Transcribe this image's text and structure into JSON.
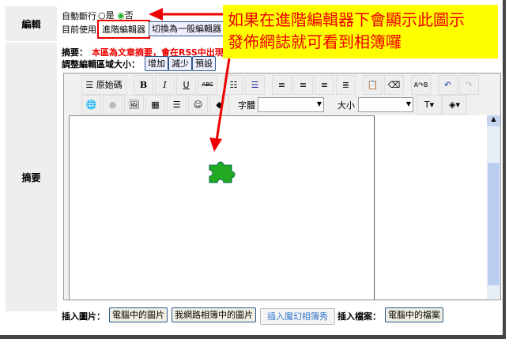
{
  "labels": {
    "edit": "編輯",
    "summary": "摘要"
  },
  "auto_wrap": {
    "label": "自動斷行",
    "yes": "是",
    "no": "否",
    "selected": "no"
  },
  "current": {
    "label": "目前使用",
    "advanced": "進階編輯器",
    "switch": "切換為一般編輯器"
  },
  "summary_note": {
    "label": "摘要：",
    "text": "本區為文章摘要，會在RSS中出現"
  },
  "resize": {
    "label": "調整編輯區域大小：",
    "increase": "增加",
    "decrease": "減少",
    "default": "預設"
  },
  "toolbar": {
    "source": "原始碼",
    "bold": "B",
    "italic": "I",
    "underline": "U",
    "strike": "ABC",
    "font_label": "字體",
    "size_label": "大小",
    "font_value": "",
    "size_value": ""
  },
  "callout": {
    "line1": "如果在進階編輯器下會顯示此圖示",
    "line2": "發佈網誌就可看到相簿囉"
  },
  "insert": {
    "image_label": "插入圖片：",
    "from_pc": "電腦中的圖片",
    "from_album": "我網路相簿中的圖片",
    "magic": "插入魔幻相簿秀",
    "file_label": "插入檔案：",
    "file_pc": "電腦中的檔案"
  },
  "colors": {
    "accent": "#e00000",
    "callout_bg": "#ffff00",
    "puzzle": "#22aa22"
  }
}
